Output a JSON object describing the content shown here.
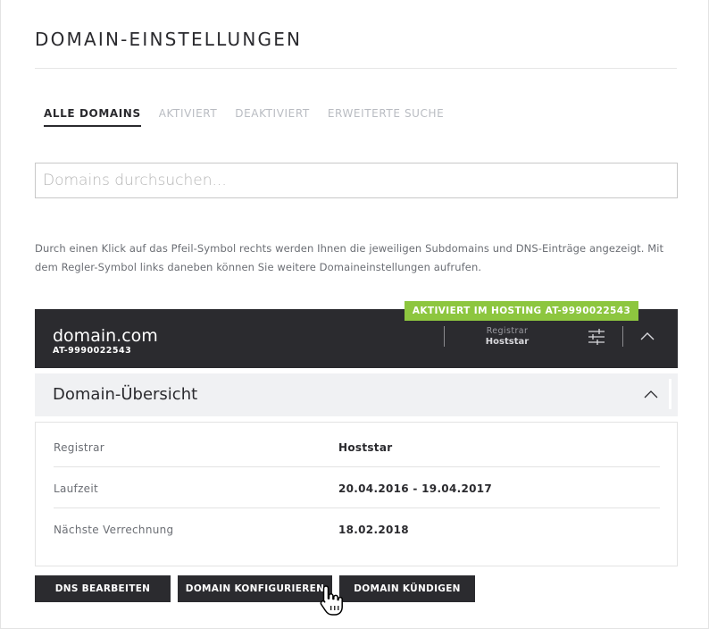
{
  "page": {
    "title": "DOMAIN-EINSTELLUNGEN"
  },
  "tabs": [
    {
      "label": "ALLE DOMAINS",
      "active": true
    },
    {
      "label": "AKTIVIERT",
      "active": false
    },
    {
      "label": "DEAKTIVIERT",
      "active": false
    },
    {
      "label": "ERWEITERTE SUCHE",
      "active": false
    }
  ],
  "search": {
    "placeholder": "Domains durchsuchen...",
    "value": ""
  },
  "info_text": "Durch einen Klick auf das Pfeil-Symbol rechts werden Ihnen die jeweiligen Subdomains und DNS-Einträge angezeigt. Mit dem Regler-Symbol links daneben können Sie weitere Domaineinstellungen aufrufen.",
  "domain": {
    "name": "domain.com",
    "id": "AT-9990022543",
    "status": "AKTIVIERT IM HOSTING AT-9990022543",
    "registrar_label": "Registrar",
    "registrar_value": "Hoststar",
    "icons": {
      "settings": "sliders-icon",
      "collapse": "chevron-up-icon"
    }
  },
  "overview": {
    "title": "Domain-Übersicht",
    "rows": [
      {
        "label": "Registrar",
        "value": "Hoststar"
      },
      {
        "label": "Laufzeit",
        "value": "20.04.2016 - 19.04.2017"
      },
      {
        "label": "Nächste Verrechnung",
        "value": "18.02.2018"
      }
    ]
  },
  "actions": {
    "dns": "DNS BEARBEITEN",
    "configure": "DOMAIN KONFIGURIEREN",
    "cancel": "DOMAIN KÜNDIGEN"
  },
  "colors": {
    "dark": "#2b2b2f",
    "status_green": "#8dc63f",
    "muted_tab": "#b9bcc2",
    "light_panel": "#f0f1f3"
  }
}
